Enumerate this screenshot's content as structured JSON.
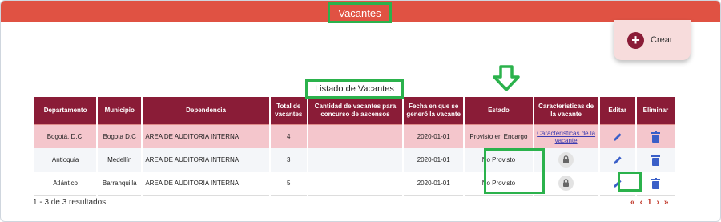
{
  "header": {
    "title": "Vacantes"
  },
  "create_button": {
    "icon": "plus-icon",
    "label": "Crear"
  },
  "list_title": "Listado de Vacantes",
  "table": {
    "columns": [
      "Departamento",
      "Municipio",
      "Dependencia",
      "Total de vacantes",
      "Cantidad de vacantes para concurso de ascensos",
      "Fecha en que se generó la vacante",
      "Estado",
      "Características de la vacante",
      "Editar",
      "Eliminar"
    ],
    "rows": [
      {
        "departamento": "Bogotá, D.C.",
        "municipio": "Bogota D.C",
        "dependencia": "AREA DE AUDITORIA INTERNA",
        "total": "4",
        "ascensos": "",
        "fecha": "2020-01-01",
        "estado": "Provisto en Encargo",
        "caracteristicas": "Características de la vacante",
        "locked": false
      },
      {
        "departamento": "Antioquia",
        "municipio": "Medellín",
        "dependencia": "AREA DE AUDITORIA INTERNA",
        "total": "3",
        "ascensos": "",
        "fecha": "2020-01-01",
        "estado": "No Provisto",
        "caracteristicas": "",
        "locked": true
      },
      {
        "departamento": "Atlántico",
        "municipio": "Barranquilla",
        "dependencia": "AREA DE AUDITORIA INTERNA",
        "total": "5",
        "ascensos": "",
        "fecha": "2020-01-01",
        "estado": "No Provisto",
        "caracteristicas": "",
        "locked": true
      }
    ]
  },
  "footer": {
    "results": "1 - 3 de 3 resultados",
    "pagination": {
      "first": "«",
      "prev": "‹",
      "current": "1",
      "next": "›",
      "last": "»"
    }
  },
  "colors": {
    "header_bg": "#e05243",
    "table_header_bg": "#8a1c37",
    "highlight": "#2bb24c",
    "icon_blue": "#3a5fc8"
  }
}
